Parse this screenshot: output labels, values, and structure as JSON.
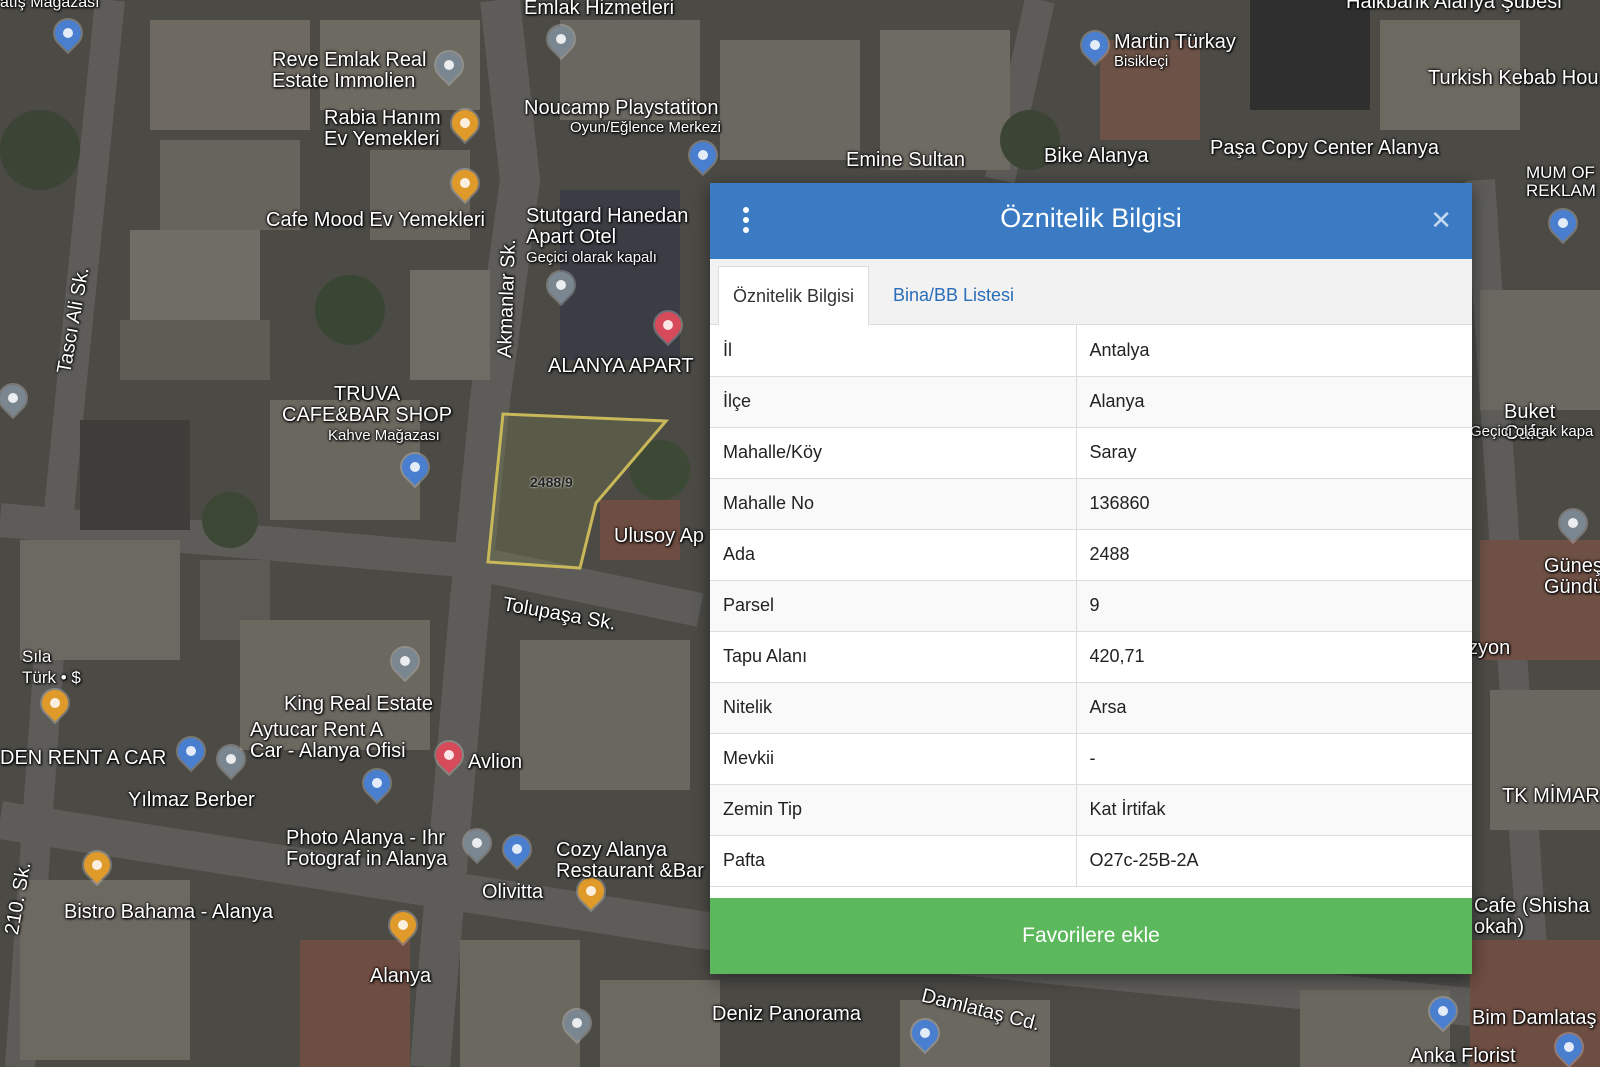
{
  "panel": {
    "title": "Öznitelik Bilgisi",
    "tabs": [
      {
        "label": "Öznitelik Bilgisi",
        "active": true
      },
      {
        "label": "Bina/BB Listesi",
        "active": false
      }
    ],
    "rows": [
      {
        "key": "İl",
        "value": "Antalya"
      },
      {
        "key": "İlçe",
        "value": "Alanya"
      },
      {
        "key": "Mahalle/Köy",
        "value": "Saray"
      },
      {
        "key": "Mahalle No",
        "value": "136860"
      },
      {
        "key": "Ada",
        "value": "2488"
      },
      {
        "key": "Parsel",
        "value": "9"
      },
      {
        "key": "Tapu Alanı",
        "value": "420,71"
      },
      {
        "key": "Nitelik",
        "value": "Arsa"
      },
      {
        "key": "Mevkii",
        "value": "-"
      },
      {
        "key": "Zemin Tip",
        "value": "Kat İrtifak"
      },
      {
        "key": "Pafta",
        "value": "O27c-25B-2A"
      }
    ],
    "favorite_button": "Favorilere ekle",
    "menu_icon": "vertical-dots-icon",
    "close_icon": "close-icon",
    "header_color": "#3a7bc4",
    "button_color": "#5cb85c"
  },
  "map": {
    "parcel_label": "2488/9",
    "labels": [
      "Emlak Hizmetleri",
      "Reve Emlak Real\nEstate Immolien",
      "Rabia Hanım\nEv Yemekleri",
      "Noucamp Playstatiton",
      "Oyun/Eğlence Merkezi",
      "Martin Türkay",
      "Bisikleçi",
      "Turkish Kebab Hou",
      "Paşa Copy Center Alanya",
      "Bike Alanya",
      "Emine Sultan",
      "MUM OF\nREKLAM",
      "Cafe Mood Ev Yemekleri",
      "Stutgard Hanedan\nApart Otel",
      "Geçici olarak kapalı",
      "Tascı Ali Sk.",
      "Akmanlar Sk.",
      "ALANYA APART",
      "TRUVA\nCAFE&BAR SHOP",
      "Kahve Mağazası",
      "Ulusoy Ap",
      "Buket Cafe",
      "Geçici olarak kapa",
      "Tolupaşa Sk.",
      "Güneş\nGündü",
      "Sıla\nTürk • $",
      "King Real Estate",
      "Aytucar Rent A\nCar - Alanya Ofisi",
      "DEN RENT A CAR",
      "Avlion",
      "Yılmaz Berber",
      "zyon",
      "TK MİMAR",
      "Photo Alanya - Ihr\nFotograf in Alanya",
      "Cozy Alanya\nRestaurant &Bar",
      "Olivitta",
      "Bistro Bahama - Alanya",
      "Cafe (Shisha\nokah)",
      "Alanya",
      "Deniz Panorama",
      "Damlataş Cd.",
      "Bim Damlataş",
      "Anka Florist",
      "210. Sk.",
      "Halkbank Alanya Şubesi",
      "atış Mağazası"
    ]
  }
}
